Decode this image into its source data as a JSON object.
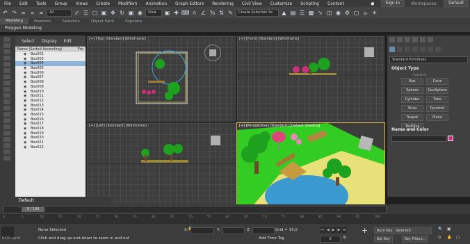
{
  "menubar": {
    "items": [
      "File",
      "Edit",
      "Tools",
      "Group",
      "Views",
      "Create",
      "Modifiers",
      "Animation",
      "Graph Editors",
      "Rendering",
      "Civil View",
      "Customize",
      "Scripting",
      "Content"
    ],
    "signin": "Sign In",
    "workspaces_label": "Workspaces:",
    "workspaces_value": "Default"
  },
  "toolbar": {
    "filter_value": "All",
    "view_value": "View",
    "selection_set_placeholder": "Create Selection Se"
  },
  "ribbon_tabs": [
    "Modeling",
    "Freeform",
    "Selection",
    "Object Paint",
    "Populate"
  ],
  "ribbon_label": "Polygon Modeling",
  "scene_explorer": {
    "tabs": [
      "Select",
      "Display",
      "Edit"
    ],
    "header": "Name (Sorted Ascending)",
    "header_col2": "Fro",
    "items": [
      "Box002",
      "Box003",
      "Box004",
      "Box005",
      "Box006",
      "Box007",
      "Box008",
      "Box009",
      "Box010",
      "Box011",
      "Box012",
      "Box013",
      "Box014",
      "Box015",
      "Box016",
      "Box017",
      "Box018",
      "Box019",
      "Box020",
      "Box021",
      "Box022"
    ],
    "selected_index": 2
  },
  "viewports": [
    {
      "label": "[+] [Top] [Standard] [Wireframe]"
    },
    {
      "label": "[+] [Front] [Standard] [Wireframe]"
    },
    {
      "label": "[+] [Left] [Standard] [Wireframe]"
    },
    {
      "label": "[+] [Perspective] [Standard] [Default Shading]"
    }
  ],
  "command_panel": {
    "dropdown": "Standard Primitives",
    "object_type_title": "Object Type",
    "autogrid": "AutoGrid",
    "buttons": [
      "Box",
      "Cone",
      "Sphere",
      "GeoSphere",
      "Cylinder",
      "Tube",
      "Torus",
      "Pyramid",
      "Teapot",
      "Plane",
      "TextPlus"
    ],
    "name_color_title": "Name and Color",
    "swatch_color": "#c8327a"
  },
  "layer": {
    "name": "Default"
  },
  "time": {
    "slider": "0 / 100",
    "ticks": [
      "0",
      "5",
      "10",
      "15",
      "20",
      "25",
      "30",
      "35",
      "40",
      "45",
      "50",
      "55",
      "60",
      "65",
      "70",
      "75",
      "80",
      "85",
      "90",
      "95",
      "100"
    ]
  },
  "status": {
    "maxscript": "MAXScript Mi",
    "selection": "None Selected",
    "prompt": "Click and drag up-and-down to zoom in and out",
    "x_label": "X:",
    "y_label": "Y:",
    "z_label": "Z:",
    "grid": "Grid = 10,0",
    "add_time_tag": "Add Time Tag",
    "auto_key": "Auto Key",
    "set_key": "Set Key",
    "selected": "Selected",
    "key_filters": "Key Filters...",
    "frame": "0"
  }
}
